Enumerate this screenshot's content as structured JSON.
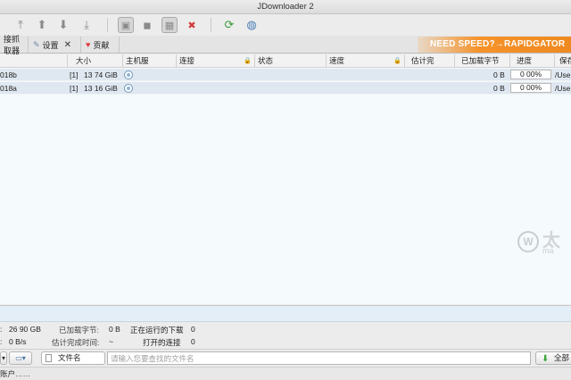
{
  "window": {
    "title": "JDownloader 2"
  },
  "toolbar": {
    "buttons": [
      {
        "name": "move-to-top-icon",
        "glyph": "⤒"
      },
      {
        "name": "move-up-icon",
        "glyph": "⬆"
      },
      {
        "name": "move-down-icon",
        "glyph": "⬇"
      },
      {
        "name": "move-to-bottom-icon",
        "glyph": "⤓"
      },
      {
        "name": "clipboard-monitor-icon",
        "glyph": "📋"
      },
      {
        "name": "silent-mode-icon",
        "glyph": "💬"
      },
      {
        "name": "auto-reconnect-icon",
        "glyph": "🖥"
      },
      {
        "name": "premium-off-icon",
        "glyph": "✖"
      },
      {
        "name": "reconnect-icon",
        "glyph": "♻"
      },
      {
        "name": "update-icon",
        "glyph": "🌐"
      }
    ]
  },
  "tabs": [
    {
      "label": "链接抓取器",
      "visible_label": "接抓取器",
      "icon": "link-grabber-icon"
    },
    {
      "label": "设置",
      "icon": "settings-icon",
      "close": "✕"
    },
    {
      "label": "贡献",
      "icon": "heart-icon"
    }
  ],
  "promo": {
    "text": "NEED SPEED?→RAPIDGATOR"
  },
  "table": {
    "columns": [
      {
        "label": "",
        "lock": false
      },
      {
        "label": "大小",
        "lock": false
      },
      {
        "label": "主机服",
        "lock": false
      },
      {
        "label": "连接",
        "lock": true
      },
      {
        "label": "状态",
        "lock": false
      },
      {
        "label": "速度",
        "lock": true
      },
      {
        "label": "估计完",
        "lock": false
      },
      {
        "label": "已加载字节",
        "lock": false
      },
      {
        "label": "进度",
        "lock": false
      },
      {
        "label": "保存",
        "lock": false
      }
    ],
    "rows": [
      {
        "name": "018b",
        "count": "[1]",
        "size": "13 74 GiB",
        "loaded": "0 B",
        "progress": "0 00%",
        "path": "/Use"
      },
      {
        "name": "018a",
        "count": "[1]",
        "size": "13 16 GiB",
        "loaded": "0 B",
        "progress": "0 00%",
        "path": "/Use"
      }
    ]
  },
  "watermark": {
    "text": "太",
    "sub": "ma"
  },
  "stats": {
    "total_size": "26 90 GB",
    "loaded_label": "已加载字节:",
    "loaded_value": "0 B",
    "running_label": "正在运行的下载",
    "running_value": "0",
    "speed": "0 B/s",
    "eta_label": "估计完成时间:",
    "eta_value": "~",
    "connections_label": "打开的连接",
    "connections_value": "0"
  },
  "search": {
    "field_label": "文件名",
    "placeholder": "请输入您要查找的文件名",
    "all_label": "全部"
  },
  "footer": {
    "text": "账户……"
  }
}
